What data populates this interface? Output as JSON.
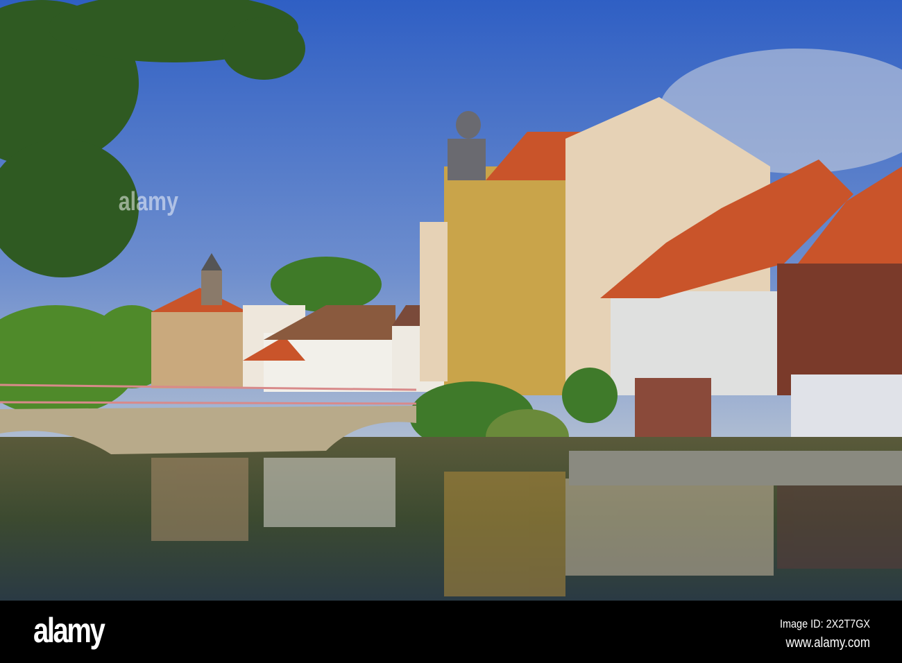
{
  "watermark": {
    "logo": "alamy",
    "image_id": "Image ID: 2X2T7GX",
    "site": "www.alamy.com"
  },
  "photo": {
    "sky_color": "#3f6fc9",
    "water_color": "#3a4a2c",
    "roof_color": "#c9542a"
  }
}
